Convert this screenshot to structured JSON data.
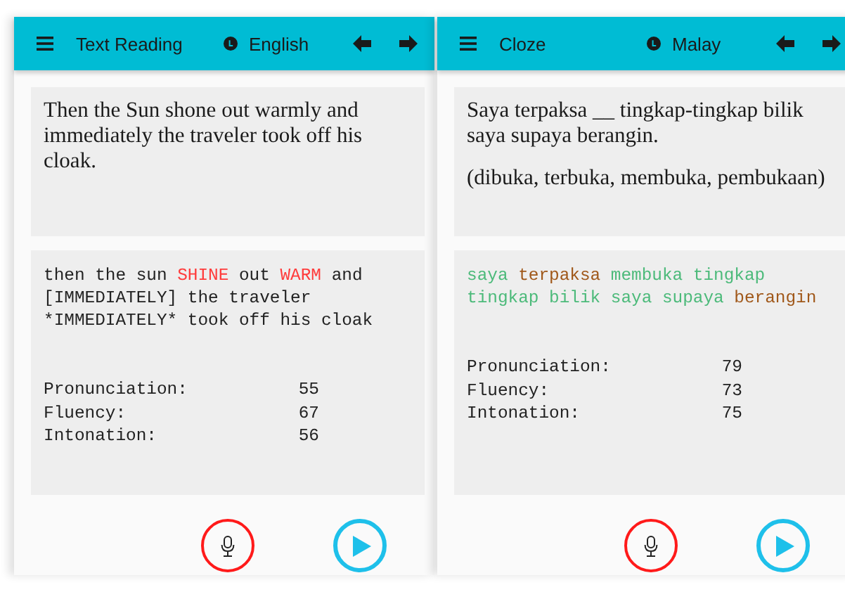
{
  "screens": [
    {
      "title": "Text Reading",
      "language": "English",
      "prompt": [
        "Then the Sun shone out warmly and immediately the traveler took off his cloak."
      ],
      "transcript": [
        {
          "text": "then the sun ",
          "color": "#222222"
        },
        {
          "text": "SHINE",
          "color": "#ff3b3b"
        },
        {
          "text": " out ",
          "color": "#222222"
        },
        {
          "text": "WARM",
          "color": "#ff3b3b"
        },
        {
          "text": " and\n[IMMEDIATELY] the traveler\n*IMMEDIATELY* took off his cloak",
          "color": "#222222"
        }
      ],
      "scores": [
        {
          "label": "Pronunciation:",
          "value": "55"
        },
        {
          "label": "Fluency:",
          "value": "67"
        },
        {
          "label": "Intonation:",
          "value": "56"
        }
      ]
    },
    {
      "title": "Cloze",
      "language": "Malay",
      "prompt": [
        "Saya terpaksa __ tingkap-tingkap bilik saya supaya berangin.",
        "(dibuka, terbuka, membuka, pembukaan)"
      ],
      "transcript": [
        {
          "text": "saya ",
          "color": "#4cba7a"
        },
        {
          "text": "terpaksa",
          "color": "#a0581a"
        },
        {
          "text": " membuka tingkap\ntingkap bilik saya supaya ",
          "color": "#4cba7a"
        },
        {
          "text": "berangin",
          "color": "#a0581a"
        }
      ],
      "scores": [
        {
          "label": "Pronunciation:",
          "value": "79"
        },
        {
          "label": "Fluency:",
          "value": "73"
        },
        {
          "label": "Intonation:",
          "value": "75"
        }
      ]
    }
  ]
}
